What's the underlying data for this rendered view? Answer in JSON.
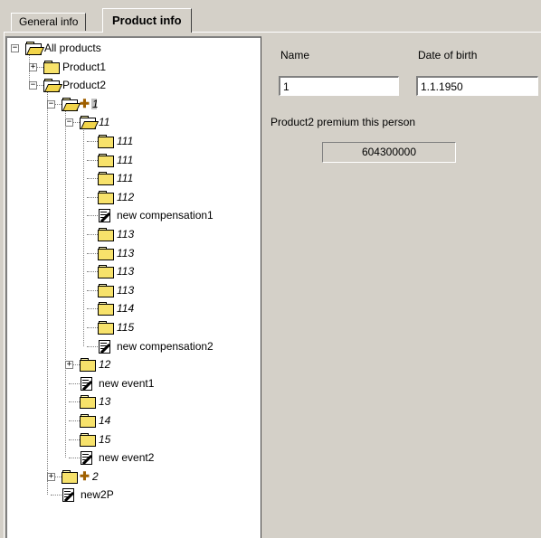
{
  "tabs": [
    {
      "label": "General info",
      "active": false
    },
    {
      "label": "Product info",
      "active": true
    }
  ],
  "tree": {
    "nodes": [
      {
        "label": "All products",
        "icon": "open-folder-icon",
        "expander": "minus",
        "italic": false
      },
      {
        "label": "Product1",
        "icon": "folder-icon",
        "expander": "plus",
        "italic": false
      },
      {
        "label": "Product2",
        "icon": "open-folder-icon",
        "expander": "minus",
        "italic": false
      },
      {
        "label": "1",
        "icon": "open-folder-icon",
        "expander": "minus",
        "italic": true,
        "selected": true
      },
      {
        "label": "11",
        "icon": "open-folder-icon",
        "expander": "minus",
        "italic": true
      },
      {
        "label": "111",
        "icon": "folder-icon",
        "italic": true
      },
      {
        "label": "111",
        "icon": "folder-icon",
        "italic": true
      },
      {
        "label": "111",
        "icon": "folder-icon",
        "italic": true
      },
      {
        "label": "112",
        "icon": "folder-icon",
        "italic": true
      },
      {
        "label": "new compensation1",
        "icon": "edit-document-icon",
        "italic": false
      },
      {
        "label": "113",
        "icon": "folder-icon",
        "italic": true
      },
      {
        "label": "113",
        "icon": "folder-icon",
        "italic": true
      },
      {
        "label": "113",
        "icon": "folder-icon",
        "italic": true
      },
      {
        "label": "113",
        "icon": "folder-icon",
        "italic": true
      },
      {
        "label": "114",
        "icon": "folder-icon",
        "italic": true
      },
      {
        "label": "115",
        "icon": "folder-icon",
        "italic": true
      },
      {
        "label": "new compensation2",
        "icon": "edit-document-icon",
        "italic": false
      },
      {
        "label": "12",
        "icon": "folder-icon",
        "expander": "plus",
        "italic": true
      },
      {
        "label": "new event1",
        "icon": "edit-document-icon",
        "italic": false
      },
      {
        "label": "13",
        "icon": "folder-icon",
        "italic": true
      },
      {
        "label": "14",
        "icon": "folder-icon",
        "italic": true
      },
      {
        "label": "15",
        "icon": "folder-icon",
        "italic": true
      },
      {
        "label": "new event2",
        "icon": "edit-document-icon",
        "italic": false
      },
      {
        "label": "2",
        "icon": "folder-icon",
        "expander": "plus",
        "italic": true
      },
      {
        "label": "new2P",
        "icon": "edit-document-icon",
        "italic": false
      }
    ]
  },
  "details": {
    "name_label": "Name",
    "name_value": "1",
    "dob_label": "Date of birth",
    "dob_value": "1.1.1950",
    "premium_label": "Product2 premium this person",
    "premium_value": "604300000"
  },
  "colors": {
    "window_bg": "#d4d0c8",
    "panel_bg": "#ffffff",
    "folder_yellow": "#f7e26b",
    "plus_icon": "#a06000"
  }
}
